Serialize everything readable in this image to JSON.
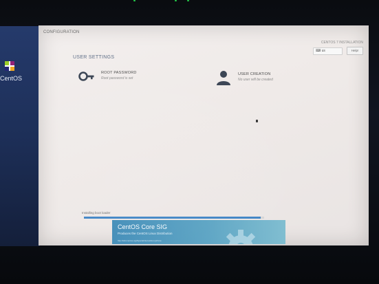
{
  "header": {
    "config_title": "CONFIGURATION",
    "install_title": "CENTOS 7 INSTALLATION",
    "keyboard_layout": "us",
    "help_label": "Help!"
  },
  "sidebar": {
    "logo_text": "CentOS",
    "logo_icon": "centos-logo-icon"
  },
  "section": {
    "title": "USER SETTINGS"
  },
  "spokes": [
    {
      "label": "ROOT PASSWORD",
      "status": "Root password is set",
      "icon": "key-icon"
    },
    {
      "label": "USER CREATION",
      "status": "No user will be created",
      "icon": "user-icon"
    }
  ],
  "progress": {
    "label": "Installing boot loader",
    "percent": 98
  },
  "banner": {
    "title": "CentOS Core SIG",
    "subtitle": "Produces the CentOS Linux Distribution",
    "footer": "http://wiki.centos.org/SpecialInterestGroup/Core",
    "icon": "gear-icon"
  },
  "colors": {
    "sidebar": "#253a6b",
    "progress_fill": "#3f84c5",
    "banner": "#4f98bf"
  }
}
